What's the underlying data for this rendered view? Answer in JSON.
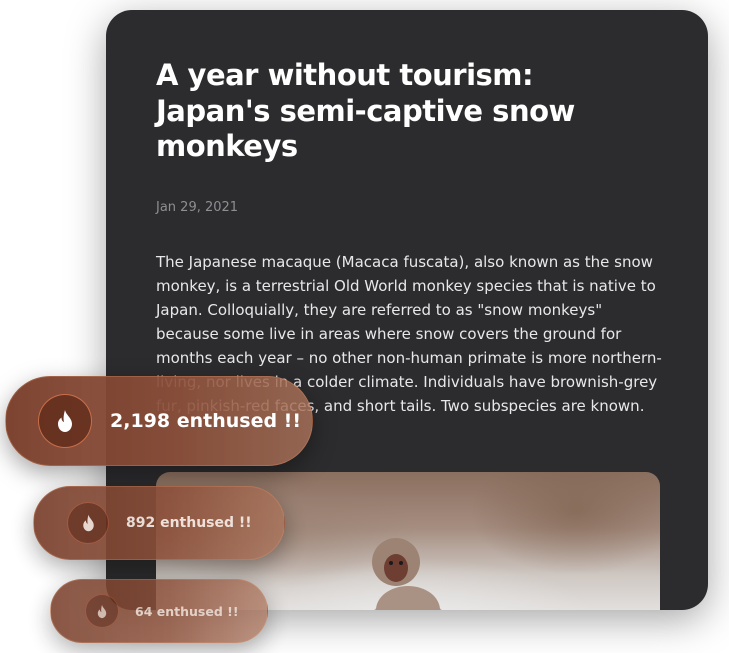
{
  "article": {
    "title": "A year without tourism: Japan's semi-captive snow monkeys",
    "date": "Jan 29, 2021",
    "body": "The Japanese macaque (Macaca fuscata), also known as the snow monkey, is a terrestrial Old World monkey species that is native to Japan. Colloquially, they are referred to as \"snow monkeys\" because some live in areas where snow covers the ground for months each year – no other non-human primate is more northern-living, nor lives in a colder climate. Individuals have brownish-grey fur, pinkish-red faces, and short tails. Two subspecies are known."
  },
  "badges": [
    {
      "label": "2,198 enthused !!",
      "icon": "flame-icon"
    },
    {
      "label": "892 enthused !!",
      "icon": "flame-icon"
    },
    {
      "label": "64 enthused !!",
      "icon": "flame-icon"
    }
  ],
  "colors": {
    "card_background": "#2c2c2e",
    "badge_accent": "#8c503a",
    "badge_ring": "#e17d55"
  }
}
